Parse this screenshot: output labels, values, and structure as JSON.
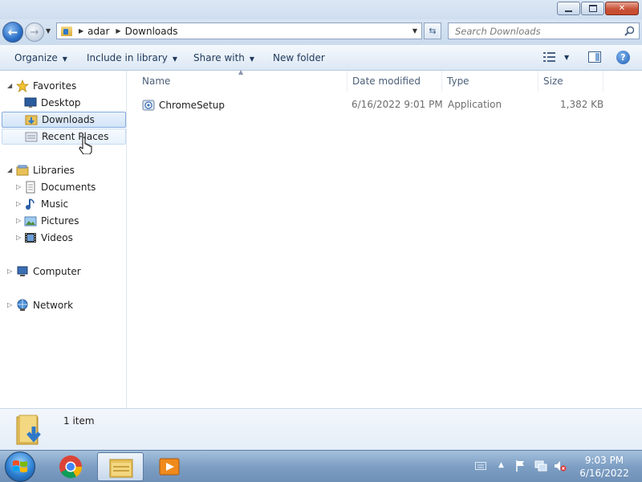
{
  "window": {
    "address": {
      "crumbs": [
        "adar",
        "Downloads"
      ],
      "search_placeholder": "Search Downloads"
    },
    "toolbar": {
      "organize": "Organize",
      "include_in_library": "Include in library",
      "share_with": "Share with",
      "new_folder": "New folder"
    },
    "nav": {
      "favorites": "Favorites",
      "desktop": "Desktop",
      "downloads": "Downloads",
      "recent_places": "Recent Places",
      "libraries": "Libraries",
      "documents": "Documents",
      "music": "Music",
      "pictures": "Pictures",
      "videos": "Videos",
      "computer": "Computer",
      "network": "Network"
    },
    "columns": {
      "name": "Name",
      "date_modified": "Date modified",
      "type": "Type",
      "size": "Size"
    },
    "files": [
      {
        "name": "ChromeSetup",
        "date_modified": "6/16/2022 9:01 PM",
        "type": "Application",
        "size": "1,382 KB"
      }
    ],
    "details": {
      "item_count": "1 item"
    }
  },
  "taskbar": {
    "clock": {
      "time": "9:03 PM",
      "date": "6/16/2022"
    }
  },
  "colors": {
    "selection_border": "#84acdd",
    "taskbar": "#7e9fc4",
    "close_button": "#c75237"
  },
  "icons": [
    "back-arrow-icon",
    "forward-arrow-icon",
    "refresh-icon",
    "search-icon",
    "folder-icon",
    "star-icon",
    "desktop-icon",
    "recent-places-icon",
    "library-icon",
    "document-icon",
    "music-icon",
    "pictures-icon",
    "videos-icon",
    "computer-icon",
    "network-icon",
    "chrome-setup-icon",
    "windows-start-icon",
    "chrome-icon",
    "explorer-icon",
    "media-player-icon",
    "keyboard-icon",
    "flag-icon",
    "network-tray-icon",
    "volume-muted-icon"
  ]
}
